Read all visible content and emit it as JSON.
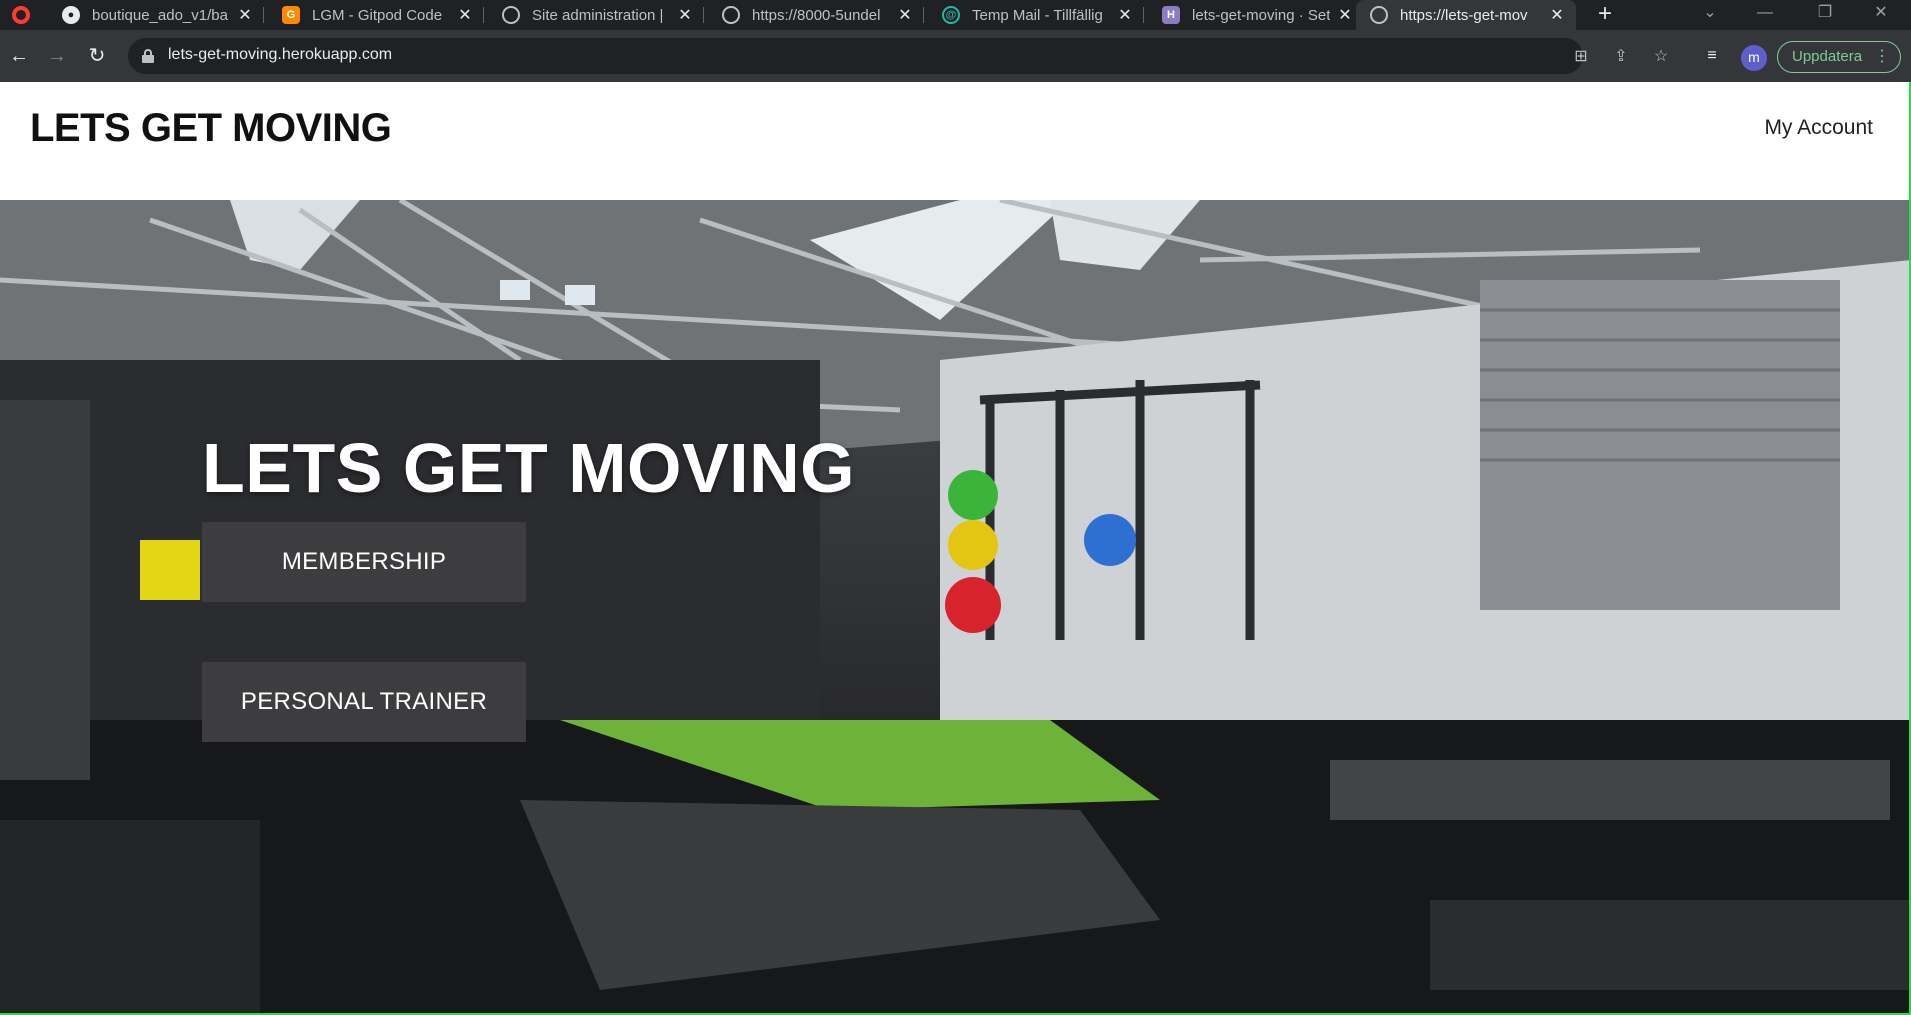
{
  "browser": {
    "tabs": [
      {
        "title": "boutique_ado_v1/ba",
        "icon": "github-icon",
        "active": false
      },
      {
        "title": "LGM - Gitpod Code",
        "icon": "gitpod-icon",
        "active": false
      },
      {
        "title": "Site administration |",
        "icon": "globe-icon",
        "active": false
      },
      {
        "title": "https://8000-5undel",
        "icon": "globe-icon",
        "active": false
      },
      {
        "title": "Temp Mail - Tillfällig",
        "icon": "tempmail-icon",
        "active": false
      },
      {
        "title": "lets-get-moving · Set",
        "icon": "heroku-icon",
        "active": false
      },
      {
        "title": "https://lets-get-mov",
        "icon": "globe-icon",
        "active": true
      }
    ],
    "url": "lets-get-moving.herokuapp.com",
    "profile_initial": "m",
    "update_label": "Uppdatera",
    "colors": {
      "accent_green": "#81c995",
      "profile": "#5d5fcf"
    }
  },
  "site": {
    "brand": "LETS GET MOVING",
    "account_link": "My Account",
    "hero": {
      "title": "LETS GET MOVING",
      "buttons": {
        "membership": "MEMBERSHIP",
        "personal_trainer": "PERSONAL TRAINER"
      }
    }
  }
}
